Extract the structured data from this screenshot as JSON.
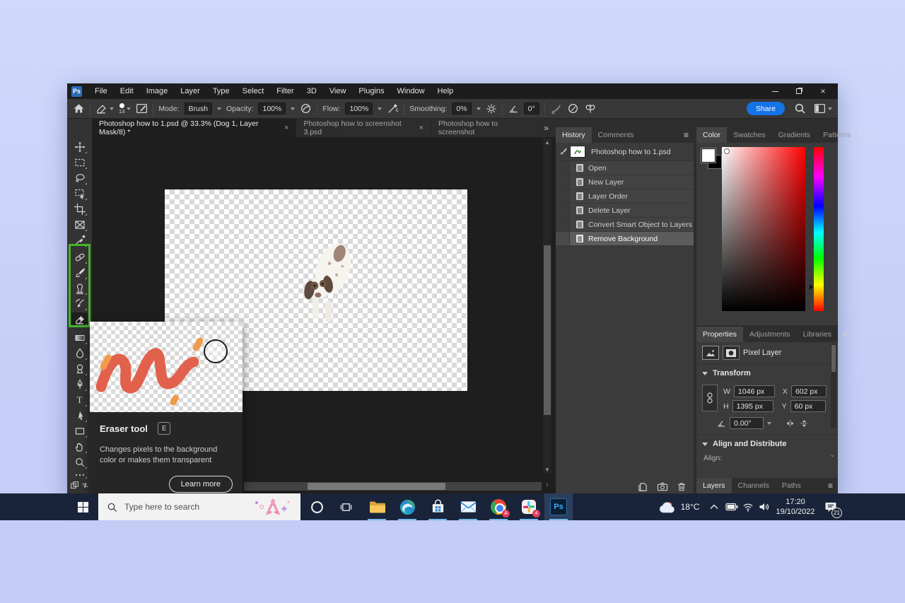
{
  "menu": {
    "logo": "Ps",
    "items": [
      "File",
      "Edit",
      "Image",
      "Layer",
      "Type",
      "Select",
      "Filter",
      "3D",
      "View",
      "Plugins",
      "Window",
      "Help"
    ]
  },
  "options": {
    "brush_size": "13",
    "mode_label": "Mode:",
    "mode_value": "Brush",
    "opacity_label": "Opacity:",
    "opacity_value": "100%",
    "flow_label": "Flow:",
    "flow_value": "100%",
    "smoothing_label": "Smoothing:",
    "smoothing_value": "0%",
    "angle_value": "0°",
    "share_label": "Share"
  },
  "doc_tabs": {
    "tabs": [
      {
        "label": "Photoshop how to 1.psd @ 33.3% (Dog 1, Layer Mask/8) *",
        "close": "×"
      },
      {
        "label": "Photoshop how to screenshot 3.psd",
        "close": "×"
      },
      {
        "label": "Photoshop how to screenshot",
        "close": ""
      }
    ],
    "overflow": "»"
  },
  "history": {
    "tab_history": "History",
    "tab_comments": "Comments",
    "snapshot": "Photoshop how to 1.psd",
    "entries": [
      "Open",
      "New Layer",
      "Layer Order",
      "Delete Layer",
      "Convert Smart Object to Layers",
      "Remove Background"
    ]
  },
  "color_panel": {
    "tabs": [
      "Color",
      "Swatches",
      "Gradients",
      "Patterns"
    ]
  },
  "properties": {
    "tabs": [
      "Properties",
      "Adjustments",
      "Libraries"
    ],
    "layer_type": "Pixel Layer",
    "transform": {
      "title": "Transform",
      "w_label": "W",
      "w_value": "1046 px",
      "x_label": "X",
      "x_value": "602 px",
      "h_label": "H",
      "h_value": "1395 px",
      "y_label": "Y",
      "y_value": "60 px",
      "angle_value": "0.00°"
    },
    "align": {
      "title": "Align and Distribute",
      "align_label": "Align:"
    }
  },
  "layers_tabs": [
    "Layers",
    "Channels",
    "Paths"
  ],
  "tooltip": {
    "title": "Eraser tool",
    "shortcut": "E",
    "description": "Changes pixels to the background color or makes them transparent",
    "button": "Learn more"
  },
  "taskbar": {
    "search_placeholder": "Type here to search",
    "temperature": "18°C",
    "time": "17:20",
    "date": "19/10/2022",
    "notification_count": "21",
    "slack_badge": "4",
    "chrome_badge": "A",
    "ps_icon": "Ps"
  },
  "icons": {
    "tools": [
      "move",
      "rectangular-marquee",
      "lasso",
      "object-selection",
      "crop",
      "frame",
      "eyedropper",
      "spot-healing-brush",
      "brush",
      "clone-stamp",
      "history-brush",
      "eraser",
      "gradient",
      "blur",
      "dodge",
      "pen",
      "type",
      "path-selection",
      "rectangle",
      "hand",
      "zoom",
      "edit-toolbar"
    ],
    "selected_tool": "eraser"
  },
  "colors": {
    "highlight_green": "#43b42c",
    "share_blue": "#1473e6",
    "taskbar_bg": "#19243a",
    "page_bg": "#c6d0f7"
  }
}
